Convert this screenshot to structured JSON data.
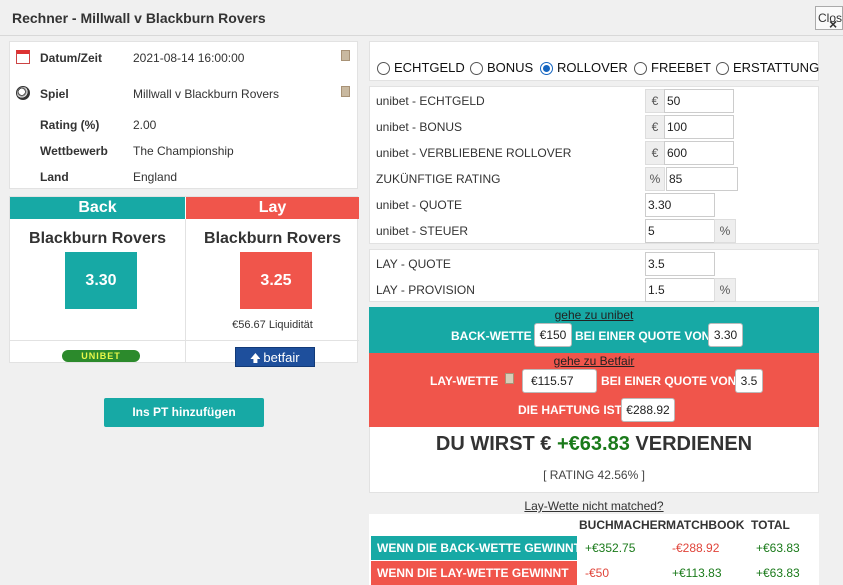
{
  "window": {
    "title": "Rechner - Millwall v Blackburn Rovers",
    "close_label": "Close",
    "close_x": "×"
  },
  "info": [
    {
      "key": "Datum/Zeit",
      "value": "2021-08-14 16:00:00",
      "icon": "calendar-icon"
    },
    {
      "key": "Spiel",
      "value": "Millwall v Blackburn Rovers",
      "icon": "football-icon"
    },
    {
      "key": "Rating (%)",
      "value": "2.00"
    },
    {
      "key": "Wettbewerb",
      "value": "The Championship"
    },
    {
      "key": "Land",
      "value": "England"
    }
  ],
  "back": {
    "header": "Back",
    "team": "Blackburn Rovers",
    "odds": "3.30",
    "bookmaker_logo": "UNIBET"
  },
  "lay": {
    "header": "Lay",
    "team": "Blackburn Rovers",
    "odds": "3.25",
    "liquidity": "€56.67 Liquidität",
    "exchange_logo": "betfair"
  },
  "add_button": "Ins PT hinzufügen",
  "modes": [
    "ECHTGELD",
    "BONUS",
    "ROLLOVER",
    "FREEBET",
    "ERSTATTUNG"
  ],
  "selected_mode": "ROLLOVER",
  "form": {
    "echtgeld": {
      "label": "unibet - ECHTGELD",
      "unit": "€",
      "value": "50"
    },
    "bonus": {
      "label": "unibet - BONUS",
      "unit": "€",
      "value": "100"
    },
    "rollover": {
      "label": "unibet - VERBLIEBENE ROLLOVER",
      "unit": "€",
      "value": "600"
    },
    "rating": {
      "label": "ZUKÜNFTIGE RATING",
      "unit": "%",
      "value": "85"
    },
    "quote": {
      "label": "unibet - QUOTE",
      "value": "3.30"
    },
    "steuer": {
      "label": "unibet - STEUER",
      "value": "5",
      "unit": "%"
    },
    "lay_quote": {
      "label": "LAY - QUOTE",
      "value": "3.5"
    },
    "lay_provision": {
      "label": "LAY - PROVISION",
      "value": "1.5",
      "unit": "%"
    }
  },
  "back_bar": {
    "link": "gehe zu unibet",
    "prefix": "BACK-WETTE",
    "stake": "€150",
    "middle": "BEI EINER QUOTE VON",
    "odds": "3.30"
  },
  "lay_bar": {
    "link": "gehe zu Betfair",
    "prefix": "LAY-WETTE",
    "stake": "€115.57",
    "middle": "BEI EINER QUOTE VON",
    "odds": "3.5",
    "liability_label": "DIE HAFTUNG IST",
    "liability": "€288.92"
  },
  "result": {
    "prefix": "DU WIRST €",
    "amount": "+€63.83",
    "suffix": "VERDIENEN",
    "rating": "[ RATING 42.56% ]"
  },
  "not_matched": "Lay-Wette nicht matched?",
  "summary": {
    "headers": [
      "BUCHMACHER",
      "MATCHBOOK",
      "TOTAL"
    ],
    "rows": [
      {
        "label": "WENN DIE BACK-WETTE GEWINNT",
        "bookmaker": "+€352.75",
        "matchbook": "-€288.92",
        "total": "+€63.83"
      },
      {
        "label": "WENN DIE LAY-WETTE GEWINNT",
        "bookmaker": "-€50",
        "matchbook": "+€113.83",
        "total": "+€63.83"
      }
    ]
  },
  "colors": {
    "teal": "#17a9a5",
    "red": "#f0554b",
    "positive": "#1a7a1a",
    "negative": "#e0443a",
    "radio_selected": "#1565c0"
  }
}
